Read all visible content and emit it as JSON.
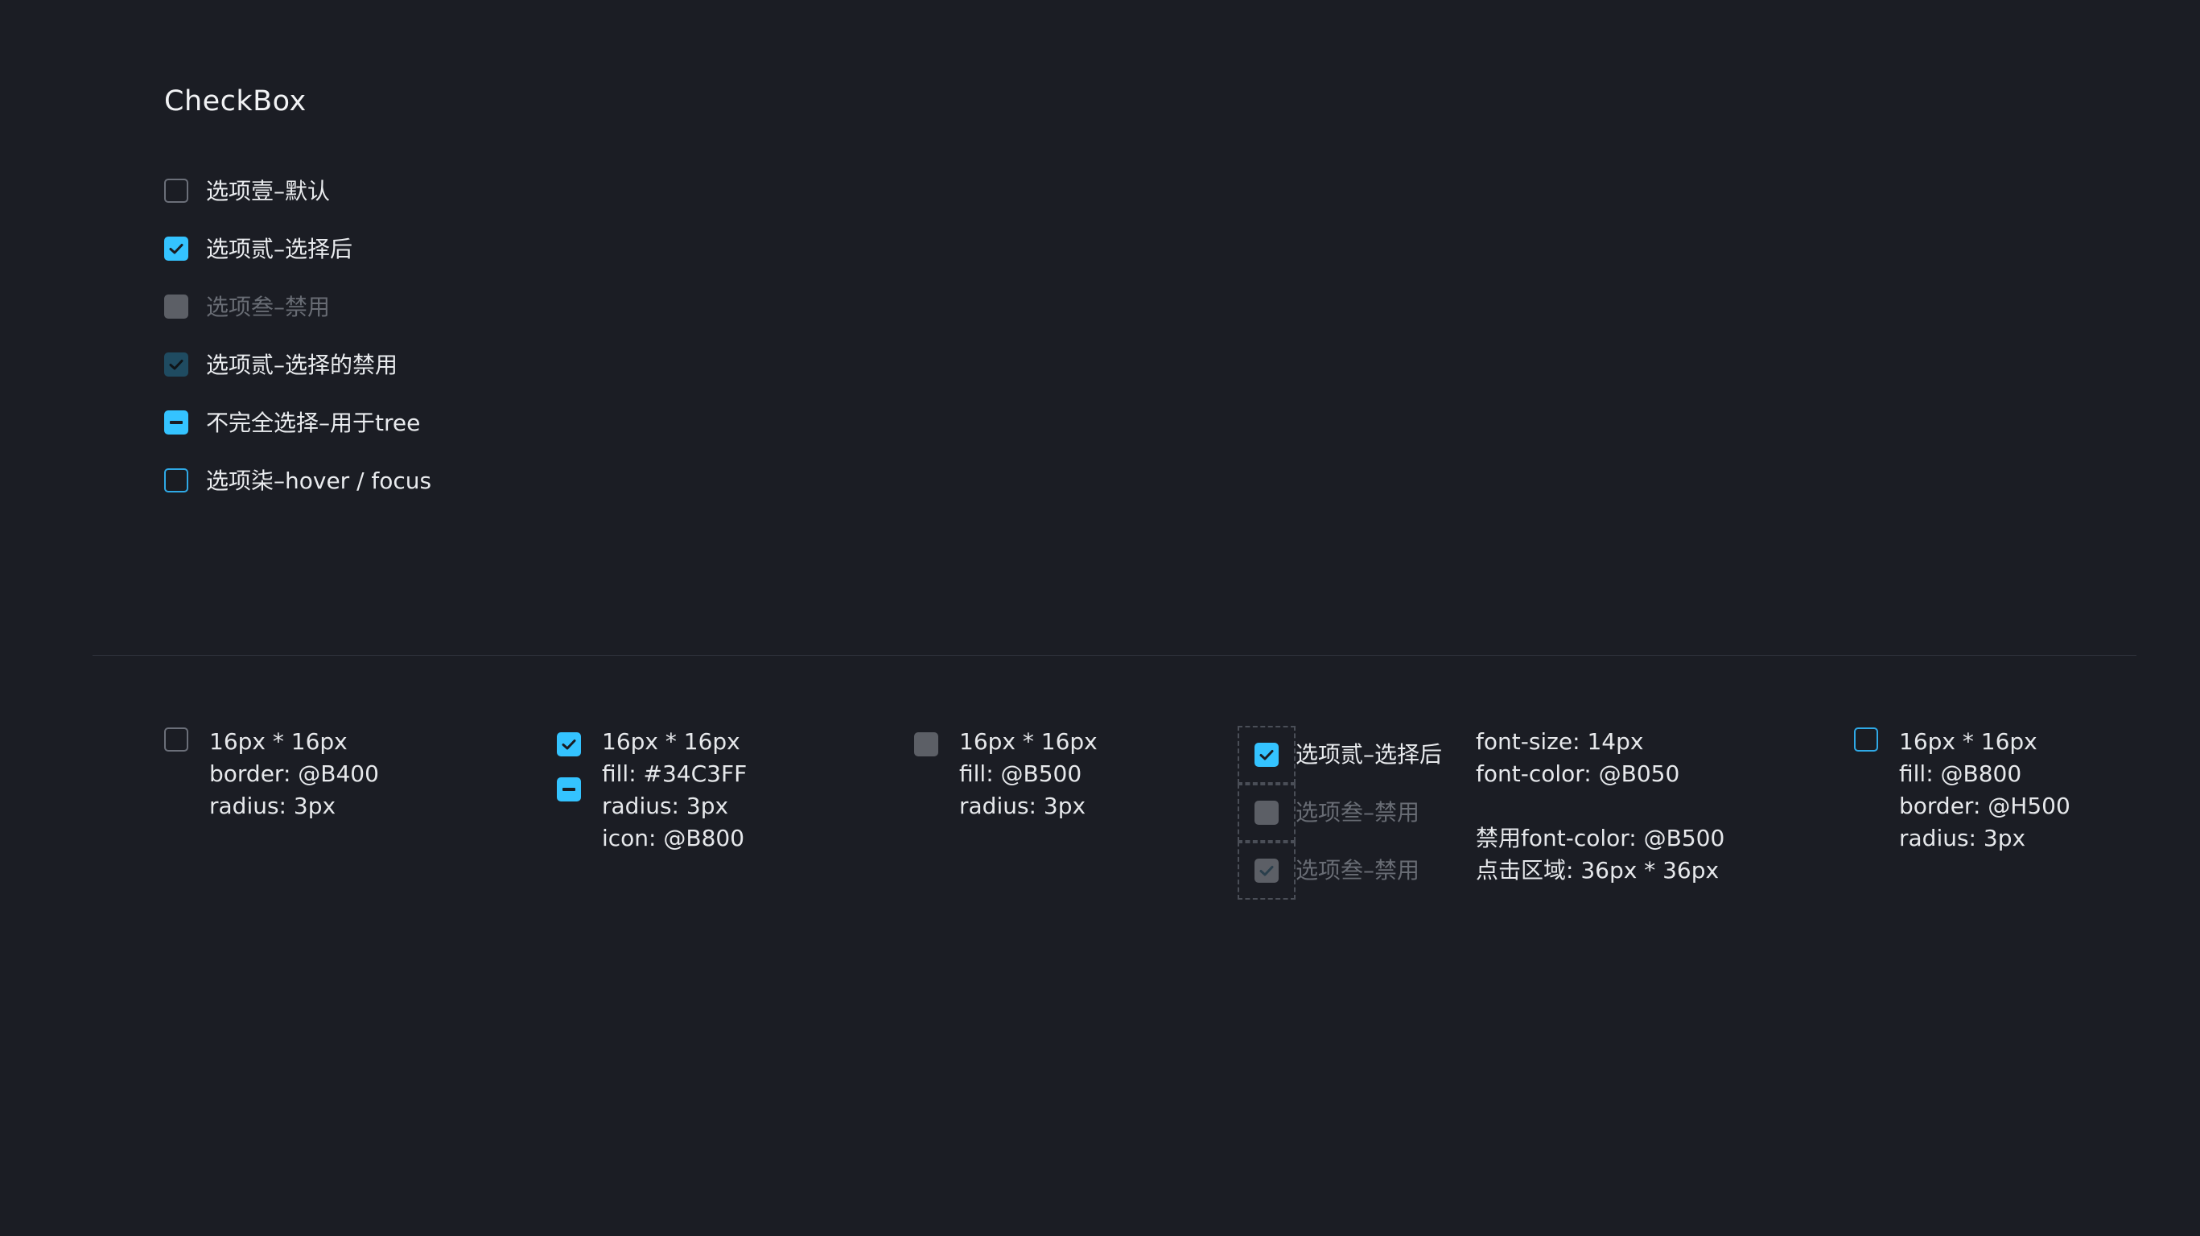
{
  "title": "CheckBox",
  "options": [
    {
      "label": "选项壹–默认",
      "state": "default"
    },
    {
      "label": "选项贰–选择后",
      "state": "checked"
    },
    {
      "label": "选项叁–禁用",
      "state": "disabled"
    },
    {
      "label": "选项贰–选择的禁用",
      "state": "checked-disabled"
    },
    {
      "label": "不完全选择–用于tree",
      "state": "indeterminate"
    },
    {
      "label": "选项柒–hover / focus",
      "state": "hover"
    }
  ],
  "colors": {
    "background": "#1b1d24",
    "fill_checked": "#34c3ff",
    "border_default": "#6b6f79",
    "fill_disabled": "#5c5f66",
    "fill_checked_disabled": "#1f4b61",
    "border_hover": "#2fa9e6",
    "text": "#e9ebee",
    "text_disabled": "#686c74"
  },
  "specs": {
    "default": [
      "16px * 16px",
      "border: @B400",
      "radius: 3px"
    ],
    "checked": [
      "16px * 16px",
      "fill: #34C3FF",
      "radius: 3px",
      "icon: @B800"
    ],
    "disabled": [
      "16px * 16px",
      "fill: @B500",
      "radius: 3px"
    ],
    "demo_labels": [
      "选项贰–选择后",
      "选项叁–禁用",
      "选项叁–禁用"
    ],
    "text": [
      "font-size: 14px",
      "font-color: @B050",
      "禁用font-color: @B500",
      "点击区域: 36px * 36px"
    ],
    "hover": [
      "16px * 16px",
      "fill: @B800",
      "border: @H500",
      "radius: 3px"
    ]
  }
}
